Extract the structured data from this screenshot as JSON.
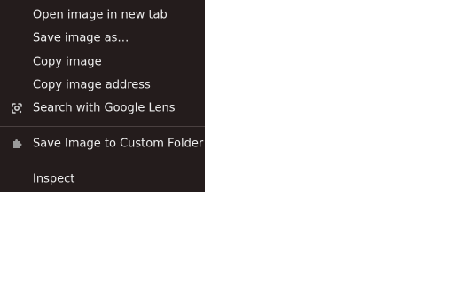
{
  "context_menu": {
    "items": [
      {
        "label": "Open image in new tab"
      },
      {
        "label": "Save image as…"
      },
      {
        "label": "Copy image"
      },
      {
        "label": "Copy image address"
      },
      {
        "label": "Search with Google Lens",
        "icon": "google-lens-icon"
      },
      {
        "label": "Save Image to Custom Folder",
        "icon": "extension-puzzle-icon"
      },
      {
        "label": "Inspect"
      }
    ]
  },
  "colors": {
    "menu_background": "#241c1c",
    "menu_text": "#eeeeee",
    "separator": "#4a4040",
    "page_background": "#ffffff"
  }
}
